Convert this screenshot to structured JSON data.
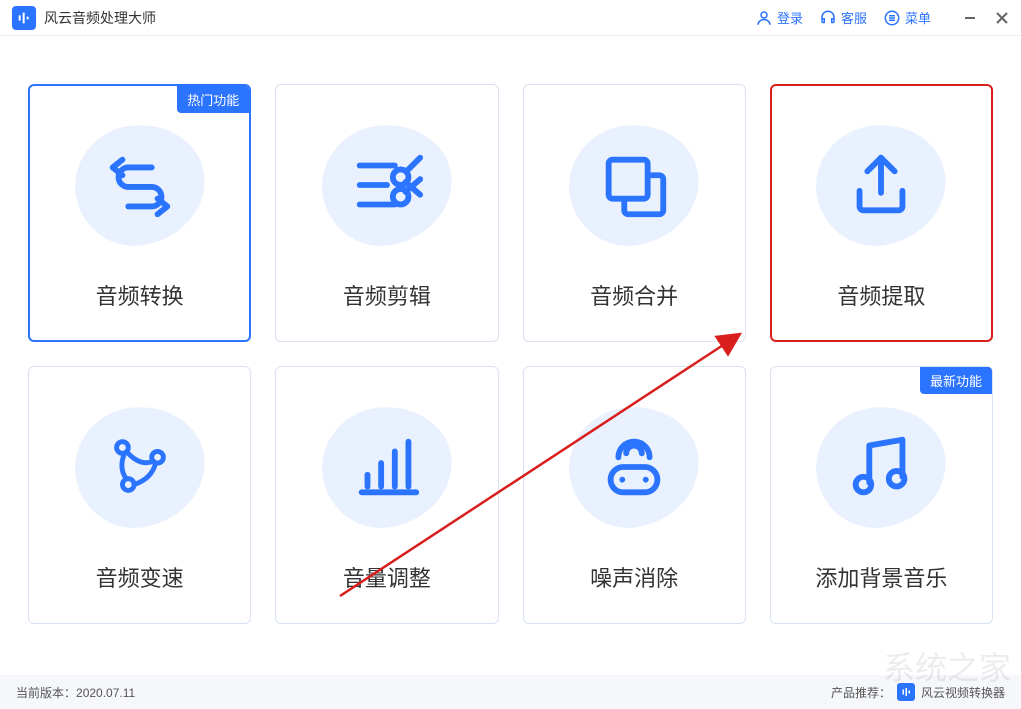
{
  "app": {
    "title": "风云音频处理大师"
  },
  "header": {
    "login": "登录",
    "support": "客服",
    "menu": "菜单"
  },
  "badges": {
    "hot": "热门功能",
    "new": "最新功能"
  },
  "cards": [
    {
      "label": "音频转换",
      "icon": "convert",
      "badge": "hot",
      "active": true
    },
    {
      "label": "音频剪辑",
      "icon": "cut"
    },
    {
      "label": "音频合并",
      "icon": "merge"
    },
    {
      "label": "音频提取",
      "icon": "extract",
      "highlighted": true
    },
    {
      "label": "音频变速",
      "icon": "speed"
    },
    {
      "label": "音量调整",
      "icon": "volume"
    },
    {
      "label": "噪声消除",
      "icon": "denoise"
    },
    {
      "label": "添加背景音乐",
      "icon": "bgm",
      "badge": "new"
    }
  ],
  "footer": {
    "version_label": "当前版本：",
    "version": "2020.07.11",
    "recommend_label": "产品推荐：",
    "recommend_product": "风云视频转换器"
  }
}
